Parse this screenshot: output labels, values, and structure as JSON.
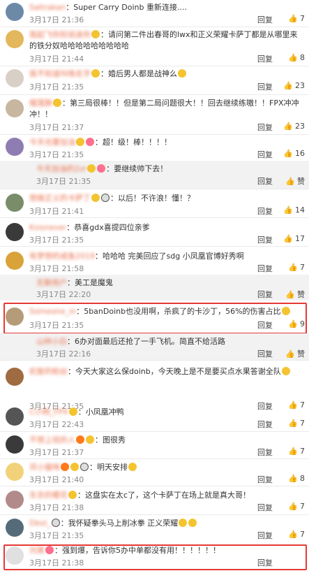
{
  "comments": [
    {
      "name": "Saltrakan",
      "content": "Super Carry Doinb 重新连接....",
      "time": "3月17日 21:36",
      "reply": "回复",
      "likes": "7"
    },
    {
      "name": "我起飞你别说迷你",
      "content": "请问第二件出春哥的lwx和正义荣耀卡萨丁都是从哪里来的铁分奴哈哈哈哈哈哈哈哈哈",
      "time": "3月17日 21:44",
      "reply": "回复",
      "likes": "8"
    },
    {
      "name": "我不知道叫啥名字",
      "content": "婚后男人都是战神么",
      "time": "3月17日 21:35",
      "reply": "回复",
      "likes": "23"
    },
    {
      "name": "榴莲酥",
      "content": "第三局很棒！！但是第二局问题很大！！回去继续练嗷！！FPX冲冲冲！！",
      "time": "3月17日 21:37",
      "reply": "回复",
      "likes": "23"
    },
    {
      "name": "今天也要加油",
      "content": "超！级！棒！！！！",
      "time": "3月17日 21:35",
      "reply": "回复",
      "likes": "16"
    },
    {
      "name": "今天加油的2zr",
      "content": "要继续帅下去！",
      "time": "3月17日 21:35",
      "reply": "回复",
      "likes": "赞",
      "sub": true
    },
    {
      "name": "想做正义的卡萨丁",
      "content": "以后！不许浪！懂！？",
      "time": "3月17日 21:41",
      "reply": "回复",
      "likes": "14"
    },
    {
      "name": "Ksisnever",
      "content": "恭喜gdx喜提四位亲爹",
      "time": "3月17日 21:35",
      "reply": "回复",
      "likes": "17"
    },
    {
      "name": "有梦想的咸鱼2019",
      "content": "哈哈哈 完美回应了sdg 小凤凰官博好秀啊",
      "time": "3月17日 21:58",
      "reply": "回复",
      "likes": "7"
    },
    {
      "name": "无聊用户",
      "content": "美工是魔鬼",
      "time": "3月17日 22:20",
      "reply": "回复",
      "likes": "赞",
      "sub": true
    },
    {
      "name": "Someone_in",
      "content": "5banDoinb也没用啊，杀疯了的卡沙丁，56%的伤害占比",
      "time": "3月17日 21:35",
      "reply": "回复",
      "likes": "9",
      "highlight": true
    },
    {
      "name": "山林小白",
      "content": "6办对面最后还抢了一手飞机。简直不给活路",
      "time": "3月17日 22:16",
      "reply": "回复",
      "likes": "赞",
      "sub": true
    },
    {
      "name": "机智的粉丝",
      "content": "今天大家这么保doinb，今天晚上是不是要买点水果答谢全队",
      "time": "3月17日 21:35",
      "reply": "回复",
      "likes": "7"
    },
    {
      "name": "C小明_FPX",
      "content": "小凤凰冲鸭",
      "time": "3月17日 22:43",
      "reply": "回复",
      "likes": "7"
    },
    {
      "name": "不想上班的人",
      "content": "图很秀",
      "time": "3月17日 21:37",
      "reply": "回复",
      "likes": "7"
    },
    {
      "name": "邓小猫咪",
      "content": "明天安排",
      "time": "3月17日 21:40",
      "reply": "回复",
      "likes": "8"
    },
    {
      "name": "东京的樱花",
      "content": "这盘实在太c了，这个卡萨丁在场上就是真大哥！",
      "time": "3月17日 21:38",
      "reply": "回复",
      "likes": "7"
    },
    {
      "name": "Dbol_",
      "content": "我怀疑拳头马上削冰拳 正义荣耀",
      "time": "3月17日 21:35",
      "reply": "回复",
      "likes": "7"
    },
    {
      "name": "刘某",
      "content": "强到爆，告诉你5办中单都没有用！！！！！！",
      "time": "3月17日 21:38",
      "reply": "回复",
      "likes": "",
      "highlight": true
    }
  ],
  "icons": {
    "like": "thumb-up-icon",
    "emoji": "emoji-icon",
    "avatar": "avatar-image"
  },
  "colors": {
    "name": "#eb7350",
    "highlight": "#e53935",
    "meta": "#888888"
  }
}
